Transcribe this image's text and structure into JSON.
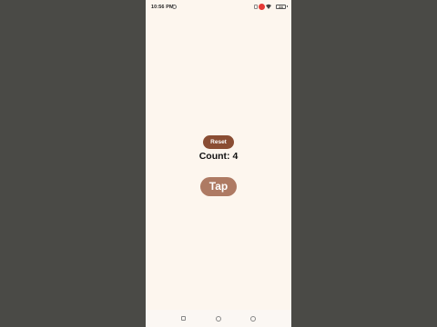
{
  "status_bar": {
    "time": "10:56 PM",
    "battery_level": "24",
    "icons": [
      "sync-icon",
      "sim-icon",
      "recording-icon",
      "wifi-icon",
      "battery-icon"
    ]
  },
  "app": {
    "reset_label": "Reset",
    "count_text": "Count: 4",
    "tap_label": "Tap"
  },
  "colors": {
    "background": "#fdf6ee",
    "reset_button": "#8a4d33",
    "tap_button": "#ae7a63",
    "outer_background": "#4a4a46"
  },
  "nav_bar": {
    "icons": [
      "recents-icon",
      "home-icon",
      "back-icon"
    ]
  }
}
